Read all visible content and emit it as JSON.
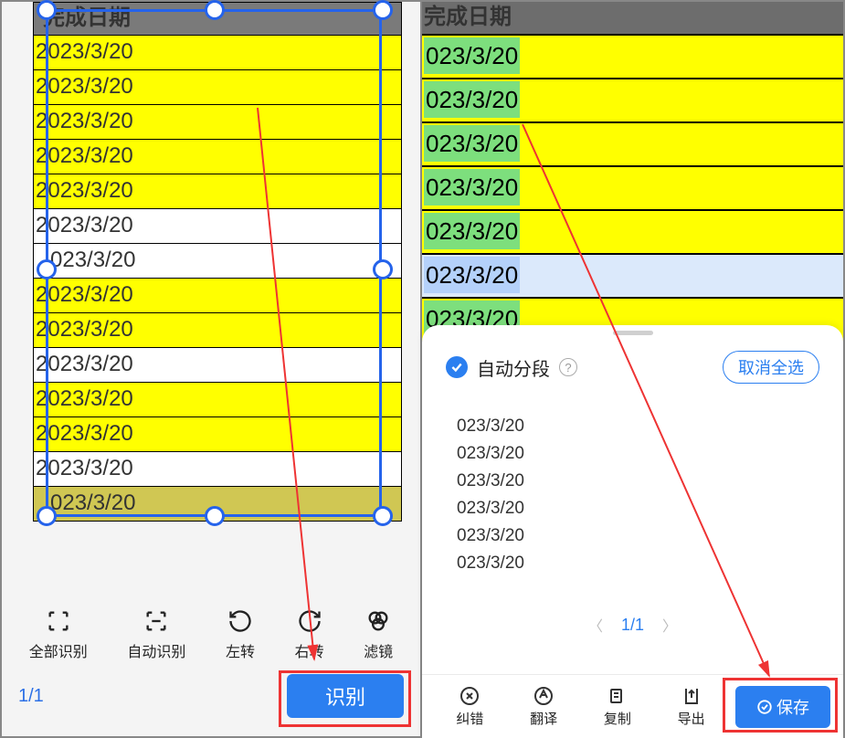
{
  "left": {
    "header_partial": "完成日期",
    "rows": [
      {
        "text": "2023/3/20",
        "bg": "yellow"
      },
      {
        "text": "2023/3/20",
        "bg": "yellow"
      },
      {
        "text": "2023/3/20",
        "bg": "yellow"
      },
      {
        "text": "2023/3/20",
        "bg": "yellow"
      },
      {
        "text": "2023/3/20",
        "bg": "yellow"
      },
      {
        "text": "2023/3/20",
        "bg": "white"
      },
      {
        "text": "2023/3/20",
        "bg": "white",
        "prefix_hidden": true
      },
      {
        "text": "2023/3/20",
        "bg": "yellow"
      },
      {
        "text": "2023/3/20",
        "bg": "yellow"
      },
      {
        "text": "2023/3/20",
        "bg": "white"
      },
      {
        "text": "2023/3/20",
        "bg": "yellow"
      },
      {
        "text": "2023/3/20",
        "bg": "yellow"
      },
      {
        "text": "2023/3/20",
        "bg": "white"
      },
      {
        "text": "2023/3/20",
        "bg": "olive",
        "prefix_hidden": true
      }
    ],
    "toolbar": [
      {
        "name": "full-recognize",
        "label": "全部识别",
        "icon": "brackets-full"
      },
      {
        "name": "auto-recognize",
        "label": "自动识别",
        "icon": "brackets-auto"
      },
      {
        "name": "rotate-left",
        "label": "左转",
        "icon": "rotate-ccw"
      },
      {
        "name": "rotate-right",
        "label": "右转",
        "icon": "rotate-cw"
      },
      {
        "name": "filter",
        "label": "滤镜",
        "icon": "filter"
      }
    ],
    "page_indicator": "1/1",
    "recognize_button": "识别"
  },
  "right": {
    "header_partial": "完成日期",
    "rows": [
      {
        "text": "023/3/20",
        "bg": "yellow"
      },
      {
        "text": "023/3/20",
        "bg": "yellow"
      },
      {
        "text": "023/3/20",
        "bg": "yellow"
      },
      {
        "text": "023/3/20",
        "bg": "yellow"
      },
      {
        "text": "023/3/20",
        "bg": "yellow"
      },
      {
        "text": "023/3/20",
        "bg": "sel"
      },
      {
        "text": "023/3/20",
        "bg": "yellow"
      }
    ],
    "sheet": {
      "auto_segment_label": "自动分段",
      "deselect_label": "取消全选",
      "segments": [
        "023/3/20",
        "023/3/20",
        "023/3/20",
        "023/3/20",
        "023/3/20",
        "023/3/20"
      ],
      "pager": "1/1"
    },
    "bottom_toolbar": [
      {
        "name": "correct",
        "label": "纠错",
        "icon": "x-circle"
      },
      {
        "name": "translate",
        "label": "翻译",
        "icon": "translate"
      },
      {
        "name": "copy",
        "label": "复制",
        "icon": "copy"
      },
      {
        "name": "export",
        "label": "导出",
        "icon": "export"
      }
    ],
    "save_button": "保存"
  }
}
